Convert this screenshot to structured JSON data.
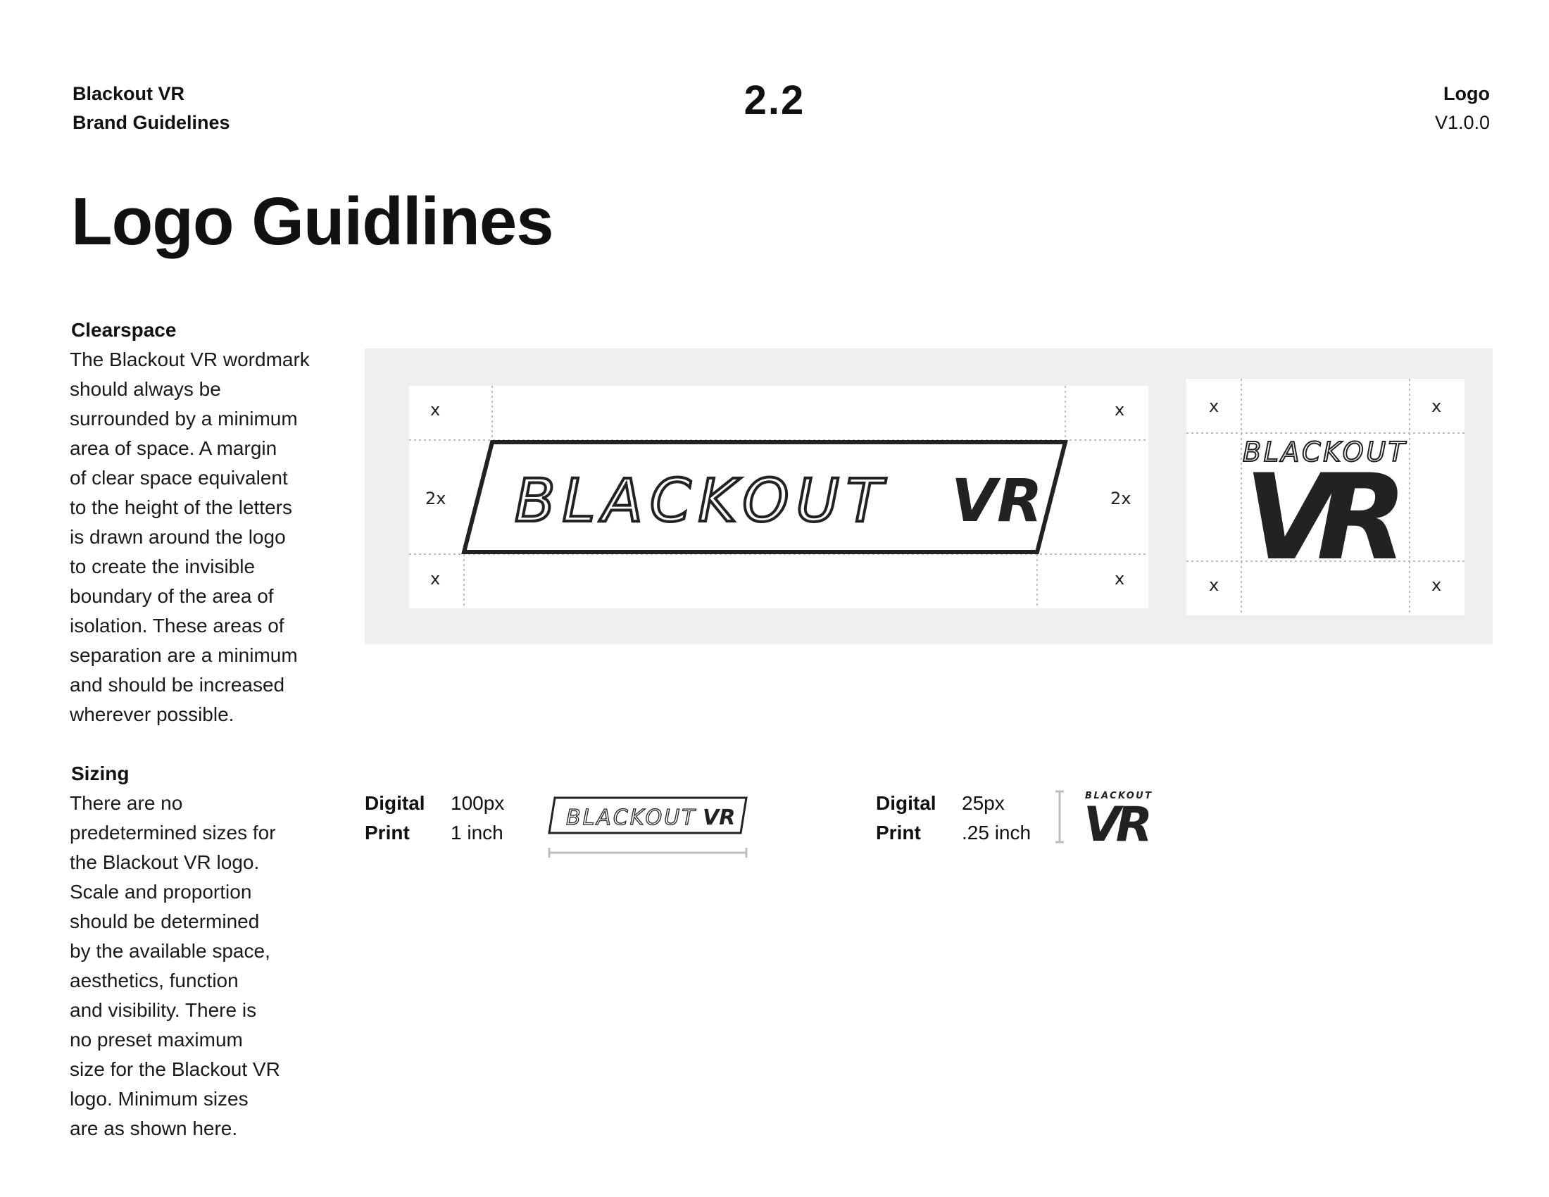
{
  "header": {
    "brand_line1": "Blackout VR",
    "brand_line2": "Brand Guidelines",
    "section_number": "2.2",
    "section_name": "Logo",
    "version": "V1.0.0"
  },
  "page_title": "Logo Guidlines",
  "clearspace": {
    "heading": "Clearspace",
    "lines": [
      "The Blackout VR wordmark",
      "should always be",
      "surrounded by a minimum",
      "area of space. A margin",
      "of clear space equivalent",
      "to the height of the letters",
      "is drawn around the logo",
      "to create the invisible",
      "boundary of the area of",
      "isolation. These areas of",
      "separation are a minimum",
      "and should be increased",
      "wherever possible."
    ],
    "markers": {
      "x": "x",
      "two_x": "2x"
    }
  },
  "logo": {
    "wordmark_text": "BLACKOUT",
    "vr_text": "VR"
  },
  "sizing": {
    "heading": "Sizing",
    "lines": [
      "There are no",
      "predetermined sizes for",
      "the Blackout VR logo.",
      "Scale and proportion",
      "should be determined",
      "by the available space,",
      "aesthetics, function",
      "and visibility. There is",
      "no preset maximum",
      "size for the Blackout VR",
      "logo. Minimum sizes",
      "are as shown here."
    ],
    "horizontal": {
      "digital_label": "Digital",
      "digital_value": "100px",
      "print_label": "Print",
      "print_value": "1 inch"
    },
    "stacked": {
      "digital_label": "Digital",
      "digital_value": "25px",
      "print_label": "Print",
      "print_value": ".25 inch"
    }
  },
  "colors": {
    "ink": "#222222",
    "panel": "#efefef",
    "guide": "#bdbdbd"
  }
}
